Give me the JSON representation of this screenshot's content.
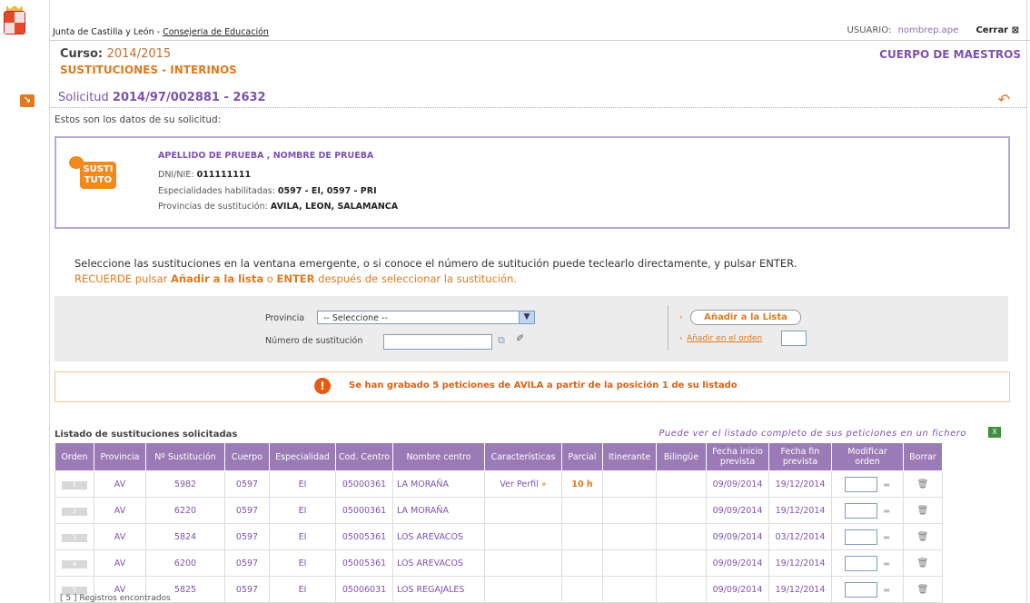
{
  "header": {
    "org": "Junta de Castilla y León",
    "separator": " - ",
    "dept": "Consejeria de Educación",
    "user_label": "USUARIO:",
    "user_name": "nombrep.ape",
    "close_label": "Cerrar"
  },
  "course": {
    "label": "Curso:",
    "year": "2014/2015",
    "section": "SUSTITUCIONES - INTERINOS",
    "cuerpo": "CUERPO DE MAESTROS"
  },
  "solicitud": {
    "label": "Solicitud",
    "number": "2014/97/002881 - 2632"
  },
  "intro": "Estos son los datos de su solicitud:",
  "card": {
    "logo_text_1": "SUSTI",
    "logo_text_2": "TUTO",
    "name": "APELLIDO DE PRUEBA , NOMBRE DE PRUEBA",
    "dni_label": "DNI/NIE:",
    "dni_value": "011111111",
    "esp_label": "Especialidades habilitadas:",
    "esp_value": "0597 - EI, 0597 - PRI",
    "prov_label": "Provincias de sustitución:",
    "prov_value": "AVILA, LEON, SALAMANCA"
  },
  "instructions": {
    "line1": "Seleccione las sustituciones en la ventana emergente, o si conoce el número de sutitución puede teclearlo directamente, y pulsar ENTER.",
    "line2_a": "RECUERDE pulsar ",
    "line2_b": "Añadir a la lista",
    "line2_c": " o ",
    "line2_d": "ENTER",
    "line2_e": " después de seleccionar la sustitución."
  },
  "form": {
    "provincia_label": "Provincia",
    "provincia_value": "-- Seleccione --",
    "numero_label": "Número de sustitución",
    "add_button": "Añadir a la Lista",
    "add_order_link": "Añadir en el orden"
  },
  "message": "Se han grabado 5 peticiones de AVILA a partir de la posición 1 de su listado",
  "list": {
    "title": "Listado de sustituciones solicitadas",
    "link": "Puede ver el listado completo de sus peticiones en un fichero",
    "columns": [
      "Orden",
      "Provincia",
      "Nº Sustitución",
      "Cuerpo",
      "Especialidad",
      "Cod. Centro",
      "Nombre centro",
      "Características",
      "Parcial",
      "Itinerante",
      "Bilingüe",
      "Fecha inicio prevista",
      "Fecha fin prevista",
      "Modificar orden",
      "Borrar"
    ],
    "rows": [
      {
        "orden": "1",
        "provincia": "AV",
        "num": "5982",
        "cuerpo": "0597",
        "esp": "EI",
        "cod": "05000361",
        "nombre": "LA MORAÑA",
        "caract": "Ver Perfil",
        "parcial": "10 h",
        "itin": "",
        "bil": "",
        "inicio": "09/09/2014",
        "fin": "19/12/2014"
      },
      {
        "orden": "2",
        "provincia": "AV",
        "num": "6220",
        "cuerpo": "0597",
        "esp": "EI",
        "cod": "05000361",
        "nombre": "LA MORAÑA",
        "caract": "",
        "parcial": "",
        "itin": "",
        "bil": "",
        "inicio": "09/09/2014",
        "fin": "19/12/2014"
      },
      {
        "orden": "3",
        "provincia": "AV",
        "num": "5824",
        "cuerpo": "0597",
        "esp": "EI",
        "cod": "05005361",
        "nombre": "LOS AREVACOS",
        "caract": "",
        "parcial": "",
        "itin": "",
        "bil": "",
        "inicio": "09/09/2014",
        "fin": "03/12/2014"
      },
      {
        "orden": "4",
        "provincia": "AV",
        "num": "6200",
        "cuerpo": "0597",
        "esp": "EI",
        "cod": "05005361",
        "nombre": "LOS AREVACOS",
        "caract": "",
        "parcial": "",
        "itin": "",
        "bil": "",
        "inicio": "09/09/2014",
        "fin": "19/12/2014"
      },
      {
        "orden": "5",
        "provincia": "AV",
        "num": "5825",
        "cuerpo": "0597",
        "esp": "EI",
        "cod": "05006031",
        "nombre": "LOS REGAJALES",
        "caract": "",
        "parcial": "",
        "itin": "",
        "bil": "",
        "inicio": "09/09/2014",
        "fin": "19/12/2014"
      }
    ],
    "footer": "[ 5 ] Registros encontrados"
  },
  "colors": {
    "accent_orange": "#e07a1f",
    "accent_purple": "#7c52b0",
    "header_purple": "#9b7bb6"
  }
}
